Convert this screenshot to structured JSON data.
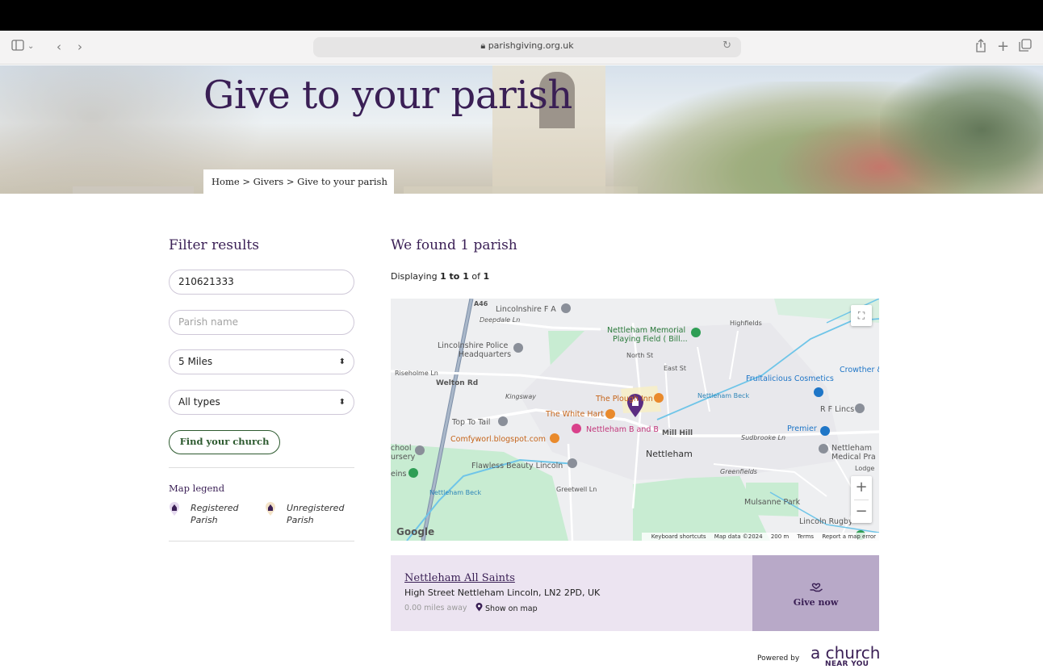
{
  "browser": {
    "url": "parishgiving.org.uk",
    "icons": [
      "sidebar-icon",
      "chevron-down-icon",
      "back-icon",
      "forward-icon",
      "lock-icon",
      "reload-icon",
      "share-icon",
      "new-tab-icon",
      "tabs-icon"
    ]
  },
  "hero": {
    "title": "Give to your parish",
    "breadcrumb": [
      "Home",
      ">",
      "Givers",
      ">",
      "Give to your parish"
    ]
  },
  "filter": {
    "title": "Filter results",
    "postcode_value": "210621333",
    "parish_name_placeholder": "Parish name",
    "distance_selected": "5 Miles",
    "type_selected": "All types",
    "find_button": "Find your church",
    "legend_title": "Map legend",
    "legend_registered": [
      "Registered",
      "Parish"
    ],
    "legend_unregistered": [
      "Unregistered",
      "Parish"
    ]
  },
  "results": {
    "title": "We found 1 parish",
    "display_prefix": "Displaying ",
    "display_range": "1 to 1",
    "display_mid": " of ",
    "display_total": "1"
  },
  "map": {
    "labels": {
      "lincolnshire_fa": "Lincolnshire F A",
      "deepdale": "Deepdale Ln",
      "a46": "A46",
      "memorial": "Nettleham Memorial",
      "memorial2": "Playing Field ( Bill...",
      "police": "Lincolnshire Police",
      "police2": "Headquarters",
      "riseholme": "Riseholme Ln",
      "highfields": "Highfields",
      "north_st": "North St",
      "east_st": "East St",
      "crowther": "Crowther &",
      "fruitalicious": "Fruitalicious Cosmetics",
      "wetton": "Welton Rd",
      "kingsway": "Kingsway",
      "plough": "The Plough Inn",
      "nettleham_beck": "Nettleham Beck",
      "rf_lincs": "R F Lincs",
      "top_to_tail": "Top To Tail",
      "white_hart": "The White Hart",
      "premier": "Premier",
      "comfy": "Comfyworl.blogspot.com",
      "bandb": "Nettleham B and B",
      "mill_hill": "Mill Hill",
      "sudbrooke": "Sudbrooke Ln",
      "medical": "Nettleham",
      "medical2": "Medical Pra",
      "school": "chool",
      "nursery": "ursery",
      "nettleham": "Nettleham",
      "greenfields": "Greenfields",
      "lodge": "Lodge",
      "flawless": "Flawless Beauty Lincoln",
      "greetwell": "Greetwell Ln",
      "beck2": "Nettleham Beck",
      "mulsanne": "Mulsanne Park",
      "rugby": "Lincoln Rugby",
      "eins": "eins"
    },
    "google": "Google",
    "footer": [
      "Keyboard shortcuts",
      "Map data ©2024",
      "200 m",
      "Terms",
      "Report a map error"
    ],
    "zoom_in": "+",
    "zoom_out": "−"
  },
  "card": {
    "name": "Nettleham All Saints",
    "address": "High Street Nettleham Lincoln, LN2 2PD, UK",
    "distance": "0.00 miles away",
    "show_on_map": "Show on map",
    "give_now": "Give now"
  },
  "footer": {
    "powered_by": "Powered by",
    "brand_top": "a church",
    "brand_bottom": "NEAR YOU"
  },
  "colors": {
    "brand_purple": "#3a1f55",
    "find_green": "#2d5a2f",
    "card_bg": "#ece4f1",
    "give_bg": "#b8a9c8"
  }
}
